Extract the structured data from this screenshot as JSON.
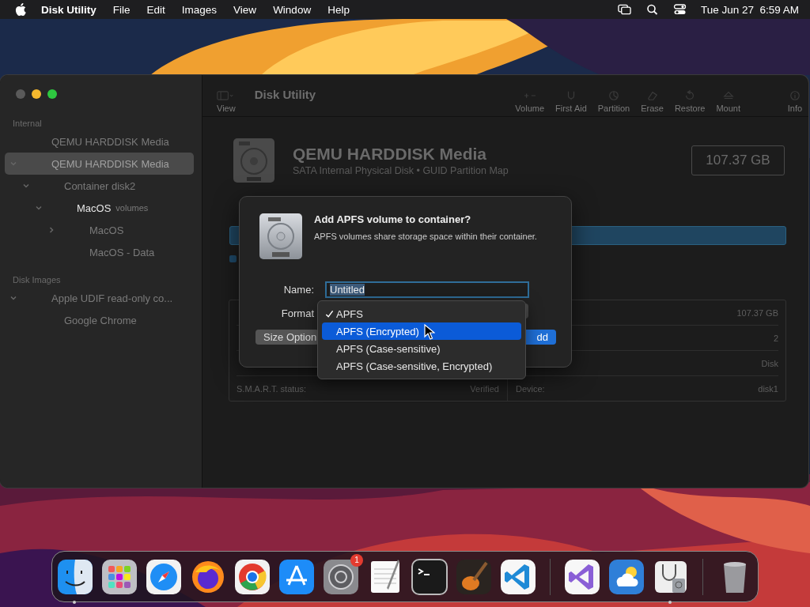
{
  "menu_bar": {
    "app": "Disk Utility",
    "menus": [
      "File",
      "Edit",
      "Images",
      "View",
      "Window",
      "Help"
    ],
    "clock": "Tue Jun 27  6:59 AM"
  },
  "window": {
    "title": "Disk Utility",
    "toolbar": [
      {
        "label": "View",
        "kind": "view"
      },
      {
        "label": "Volume",
        "kind": "volume"
      },
      {
        "label": "First Aid",
        "kind": "firstaid"
      },
      {
        "label": "Partition",
        "kind": "partition"
      },
      {
        "label": "Erase",
        "kind": "erase"
      },
      {
        "label": "Restore",
        "kind": "restore"
      },
      {
        "label": "Mount",
        "kind": "mount"
      },
      {
        "label": "Info",
        "kind": "info"
      }
    ],
    "sidebar": [
      {
        "title": "Internal",
        "items": [
          {
            "label": "QEMU HARDDISK Media",
            "selected": false
          },
          {
            "label": "QEMU HARDDISK Media",
            "selected": true,
            "expanded": true,
            "children": [
              {
                "label": "Container disk2",
                "selected": false,
                "expanded": true,
                "children": [
                  {
                    "label": "MacOS",
                    "suffix": "volumes",
                    "selected": false,
                    "expanded": true,
                    "children": [
                      {
                        "label": "MacOS",
                        "selected": false,
                        "expanded": false
                      },
                      {
                        "label": "MacOS - Data",
                        "selected": false
                      }
                    ]
                  }
                ]
              }
            ]
          }
        ]
      },
      {
        "title": "Disk Images",
        "items": [
          {
            "label": "Apple UDIF read-only co...",
            "selected": false,
            "expanded": true,
            "children": [
              {
                "label": "Google Chrome",
                "selected": false
              }
            ]
          }
        ]
      }
    ],
    "disk": {
      "name": "QEMU HARDDISK Media",
      "description": "SATA Internal Physical Disk • GUID Partition Map",
      "size": "107.37 GB"
    },
    "info_rows": [
      {
        "value_2": "107.37 GB"
      },
      {
        "value_2": "2"
      },
      {
        "value_2": "Disk"
      },
      {
        "label_1": "S.M.A.R.T. status:",
        "value_1": "Verified",
        "label_2": "Device:",
        "value_2": "disk1"
      }
    ]
  },
  "dialog": {
    "title": "Add APFS volume to container?",
    "message": "APFS volumes share storage space within their container.",
    "name_label": "Name:",
    "name_value": "Untitled",
    "name_text_selected": true,
    "format_label": "Format",
    "size_button": "Size Option",
    "add_button": "dd"
  },
  "format_menu": [
    {
      "label": "APFS",
      "checked": true,
      "selected": false
    },
    {
      "label": "APFS (Encrypted)",
      "checked": false,
      "selected": true
    },
    {
      "label": "APFS (Case-sensitive)",
      "checked": false,
      "selected": false
    },
    {
      "label": "APFS (Case-sensitive, Encrypted)",
      "checked": false,
      "selected": false
    }
  ],
  "dock": [
    {
      "kind": "finder",
      "running": true
    },
    {
      "kind": "launchpad",
      "running": false
    },
    {
      "kind": "safari",
      "running": false
    },
    {
      "kind": "firefox",
      "running": false
    },
    {
      "kind": "chrome",
      "running": false
    },
    {
      "kind": "appstore",
      "running": false
    },
    {
      "kind": "settings",
      "running": false,
      "badge": "1"
    },
    {
      "kind": "textedit",
      "running": false
    },
    {
      "kind": "terminal",
      "running": false
    },
    {
      "kind": "garageband",
      "running": false
    },
    {
      "kind": "vscode",
      "running": false
    },
    {
      "kind": "separator"
    },
    {
      "kind": "visualstudio",
      "running": false
    },
    {
      "kind": "weather",
      "running": false
    },
    {
      "kind": "diskutility",
      "running": true
    },
    {
      "kind": "separator"
    },
    {
      "kind": "trash",
      "running": false
    }
  ]
}
